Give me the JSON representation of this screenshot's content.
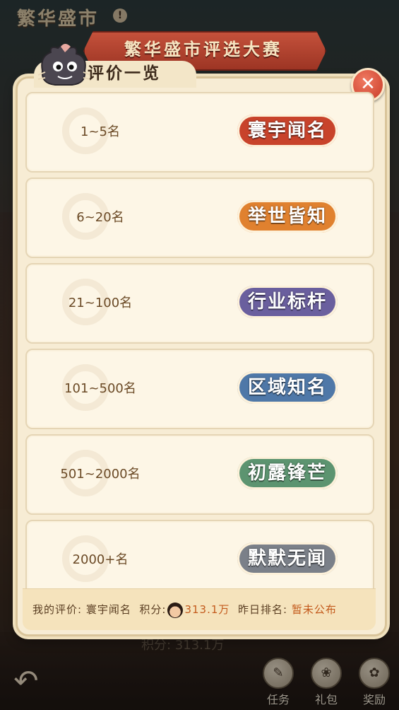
{
  "background": {
    "title": "繁华盛市",
    "info_icon": "!",
    "score_text": "积分: 313.1万",
    "nav": [
      {
        "label": "任务",
        "icon": "task-icon"
      },
      {
        "label": "礼包",
        "icon": "gift-bag-icon"
      },
      {
        "label": "奖励",
        "icon": "reward-icon"
      }
    ]
  },
  "banner": {
    "title": "繁华盛市评选大赛"
  },
  "panel": {
    "title": "评价一览",
    "close_glyph": "✕",
    "rows": [
      {
        "rank": "1~5名",
        "rating": "寰宇闻名",
        "color": "#c8432b"
      },
      {
        "rank": "6~20名",
        "rating": "举世皆知",
        "color": "#e0812f"
      },
      {
        "rank": "21~100名",
        "rating": "行业标杆",
        "color": "#6a5f9e"
      },
      {
        "rank": "101~500名",
        "rating": "区域知名",
        "color": "#4f78a8"
      },
      {
        "rank": "501~2000名",
        "rating": "初露锋芒",
        "color": "#5c9470"
      },
      {
        "rank": "2000+名",
        "rating": "默默无闻",
        "color": "#7b8089"
      }
    ],
    "footer": {
      "my_rating_label": "我的评价:",
      "my_rating": "寰宇闻名",
      "score_label": "积分:",
      "score": "313.1万",
      "rank_label": "昨日排名:",
      "rank_value": "暂未公布"
    }
  },
  "back_icon": "back-arrow-icon"
}
